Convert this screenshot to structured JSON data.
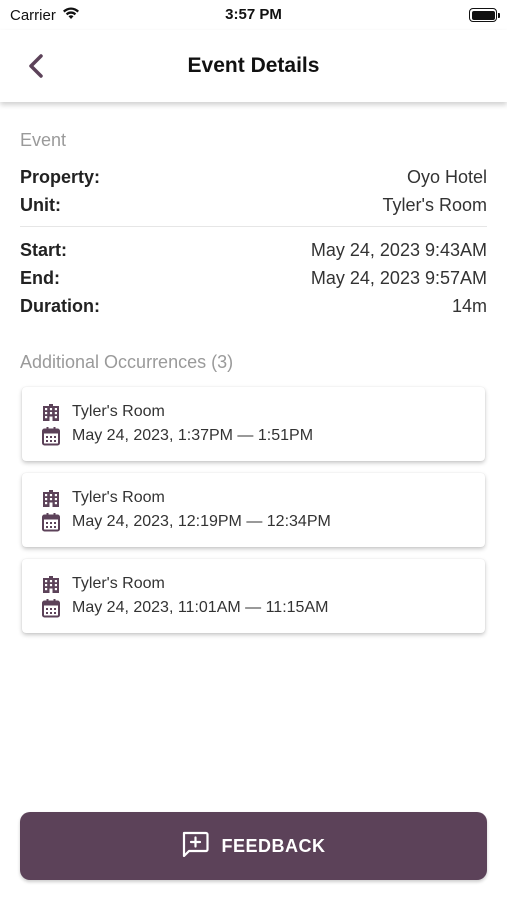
{
  "status_bar": {
    "carrier": "Carrier",
    "time": "3:57 PM",
    "battery_level": 1.0
  },
  "header": {
    "title": "Event Details",
    "back_icon": "chevron-left-icon"
  },
  "event": {
    "section_label": "Event",
    "property_label": "Property:",
    "property_value": "Oyo Hotel",
    "unit_label": "Unit:",
    "unit_value": "Tyler's Room",
    "start_label": "Start:",
    "start_value": "May 24, 2023 9:43AM",
    "end_label": "End:",
    "end_value": "May 24, 2023 9:57AM",
    "duration_label": "Duration:",
    "duration_value": "14m"
  },
  "occurrences": {
    "section_label": "Additional Occurrences (3)",
    "items": [
      {
        "unit": "Tyler's Room",
        "time": "May 24, 2023,  1:37PM — 1:51PM"
      },
      {
        "unit": "Tyler's Room",
        "time": "May 24, 2023,  12:19PM — 12:34PM"
      },
      {
        "unit": "Tyler's Room",
        "time": "May 24, 2023,  11:01AM — 11:15AM"
      }
    ]
  },
  "feedback": {
    "label": "FEEDBACK",
    "icon": "feedback-add-icon"
  },
  "colors": {
    "accent": "#5c4259",
    "muted_text": "#9a9a9a"
  }
}
